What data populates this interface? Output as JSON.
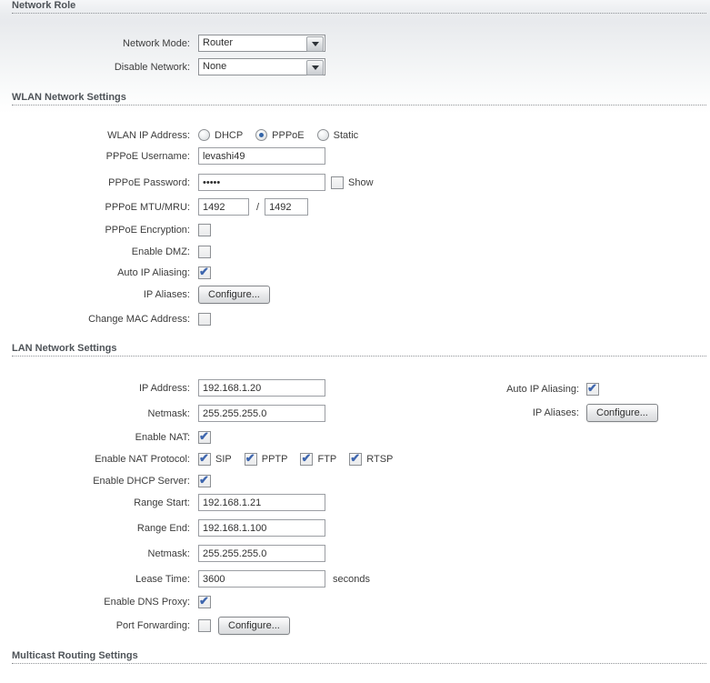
{
  "headers": {
    "network_role": "Network Role",
    "wlan": "WLAN Network Settings",
    "lan": "LAN Network Settings",
    "multicast": "Multicast Routing Settings"
  },
  "network_role": {
    "network_mode_label": "Network Mode:",
    "network_mode_value": "Router",
    "disable_network_label": "Disable Network:",
    "disable_network_value": "None"
  },
  "wlan": {
    "ip_address_label": "WLAN IP Address:",
    "ip_modes": [
      {
        "label": "DHCP",
        "selected": false
      },
      {
        "label": "PPPoE",
        "selected": true
      },
      {
        "label": "Static",
        "selected": false
      }
    ],
    "username_label": "PPPoE Username:",
    "username_value": "levashi49",
    "password_label": "PPPoE Password:",
    "password_value": "•••••",
    "show_label": "Show",
    "show_checked": false,
    "mtu_label": "PPPoE MTU/MRU:",
    "mtu_value": "1492",
    "mtu_separator": "/",
    "mru_value": "1492",
    "encryption_label": "PPPoE Encryption:",
    "encryption_checked": false,
    "dmz_label": "Enable DMZ:",
    "dmz_checked": false,
    "auto_ip_label": "Auto IP Aliasing:",
    "auto_ip_checked": true,
    "ip_aliases_label": "IP Aliases:",
    "ip_aliases_button": "Configure...",
    "change_mac_label": "Change MAC Address:",
    "change_mac_checked": false
  },
  "lan": {
    "ip_label": "IP Address:",
    "ip_value": "192.168.1.20",
    "netmask_label": "Netmask:",
    "netmask_value": "255.255.255.0",
    "auto_ip_label": "Auto IP Aliasing:",
    "auto_ip_checked": true,
    "ip_aliases_label": "IP Aliases:",
    "ip_aliases_button": "Configure...",
    "nat_label": "Enable NAT:",
    "nat_checked": true,
    "nat_protocol_label": "Enable NAT Protocol:",
    "nat_protocols": [
      {
        "label": "SIP",
        "checked": true
      },
      {
        "label": "PPTP",
        "checked": true
      },
      {
        "label": "FTP",
        "checked": true
      },
      {
        "label": "RTSP",
        "checked": true
      }
    ],
    "dhcp_label": "Enable DHCP Server:",
    "dhcp_checked": true,
    "range_start_label": "Range Start:",
    "range_start_value": "192.168.1.21",
    "range_end_label": "Range End:",
    "range_end_value": "192.168.1.100",
    "netmask2_label": "Netmask:",
    "netmask2_value": "255.255.255.0",
    "lease_label": "Lease Time:",
    "lease_value": "3600",
    "lease_unit": "seconds",
    "dns_proxy_label": "Enable DNS Proxy:",
    "dns_proxy_checked": true,
    "port_forwarding_label": "Port Forwarding:",
    "port_forwarding_checked": false,
    "port_forwarding_button": "Configure..."
  }
}
